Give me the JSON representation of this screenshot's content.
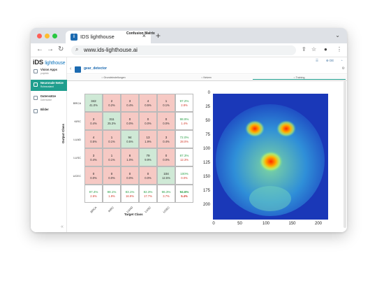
{
  "browser": {
    "tab_title": "IDS lighthouse",
    "close_glyph": "×",
    "new_tab_glyph": "+",
    "url": "www.ids-lighthouse.ai",
    "traffic_colors": [
      "#ff5f57",
      "#febc2e",
      "#28c840"
    ]
  },
  "sidebar": {
    "logo": "iDS",
    "logo_sub": "lighthouse",
    "items": [
      {
        "label": "Vision Apps",
        "sub": "projektiv"
      },
      {
        "label": "Neuronale Netze",
        "sub": "Ruhezustand"
      },
      {
        "label": "Datensätze",
        "sub": "Datensätze"
      },
      {
        "label": "Bilder",
        "sub": ""
      }
    ],
    "collapse_glyph": "«"
  },
  "top_icons": [
    "DE"
  ],
  "project": {
    "name": "gear_detector"
  },
  "tabs": [
    "Grundeinstellungen",
    "Netzen",
    "Training"
  ],
  "confusion": {
    "title": "Confusion Matrix",
    "ylabel": "Output Class",
    "xlabel": "Target Class",
    "row_labels": [
      "BRCA",
      "KIRC",
      "LUAD",
      "LUSC",
      "UCEC"
    ],
    "col_labels": [
      "BRCA",
      "KIRC",
      "LUAD",
      "LUSC",
      "UCEC"
    ],
    "cells": [
      [
        [
          "342",
          "41.0%"
        ],
        [
          "2",
          "0.2%"
        ],
        [
          "3",
          "0.4%"
        ],
        [
          "4",
          "0.5%"
        ],
        [
          "1",
          "0.1%"
        ],
        [
          "97.2%",
          "2.8%"
        ]
      ],
      [
        [
          "3",
          "0.4%"
        ],
        [
          "311",
          "25.3%"
        ],
        [
          "0",
          "0.0%"
        ],
        [
          "0",
          "0.0%"
        ],
        [
          "0",
          "0.0%"
        ],
        [
          "98.9%",
          "1.4%"
        ]
      ],
      [
        [
          "4",
          "0.5%"
        ],
        [
          "1",
          "0.1%"
        ],
        [
          "94",
          "0.5%"
        ],
        [
          "13",
          "1.9%"
        ],
        [
          "3",
          "0.4%"
        ],
        [
          "72.0%",
          "28.0%"
        ]
      ],
      [
        [
          "3",
          "0.4%"
        ],
        [
          "1",
          "0.1%"
        ],
        [
          "8",
          "1.0%"
        ],
        [
          "79",
          "9.9%"
        ],
        [
          "0",
          "0.0%"
        ],
        [
          "87.3%",
          "12.3%"
        ]
      ],
      [
        [
          "0",
          "0.0%"
        ],
        [
          "0",
          "0.0%"
        ],
        [
          "0",
          "0.0%"
        ],
        [
          "0",
          "0.0%"
        ],
        [
          "104",
          "12.5%"
        ],
        [
          "100%",
          "0.0%"
        ]
      ],
      [
        [
          "97.4%",
          "2.6%"
        ],
        [
          "98.1%",
          "1.9%"
        ],
        [
          "83.1%",
          "16.9%"
        ],
        [
          "82.3%",
          "17.7%"
        ],
        [
          "96.3%",
          "3.7%"
        ],
        [
          "94.6%",
          "5.4%"
        ]
      ]
    ]
  },
  "heatmap": {
    "y_ticks": [
      "0",
      "25",
      "50",
      "75",
      "100",
      "125",
      "150",
      "175",
      "200"
    ],
    "x_ticks": [
      "0",
      "50",
      "100",
      "150",
      "200"
    ]
  }
}
